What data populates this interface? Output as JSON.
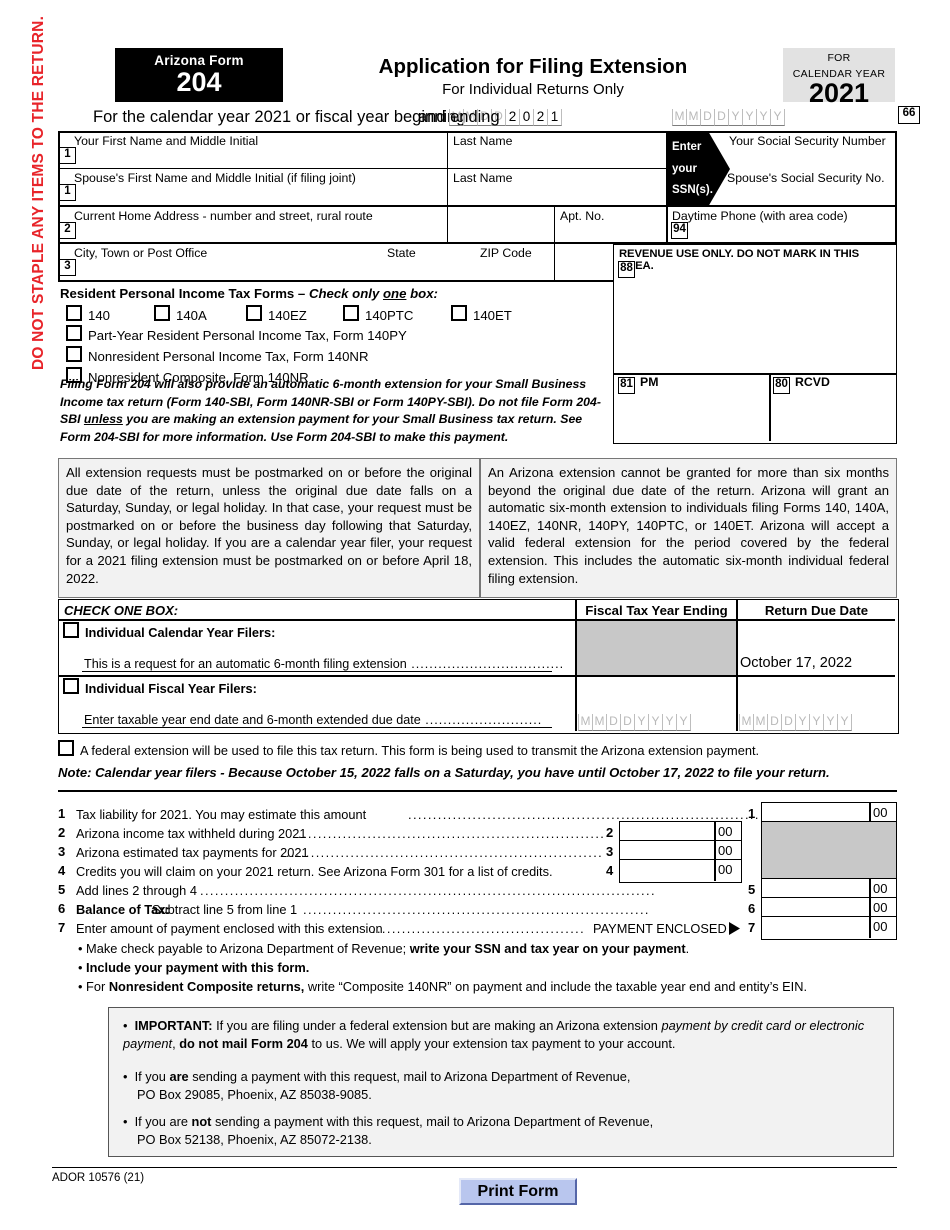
{
  "warning_vertical": "DO NOT STAPLE ANY ITEMS TO THE RETURN.",
  "header": {
    "agency_line": "Arizona Form",
    "form_number": "204",
    "title": "Application for Filing Extension",
    "subtitle": "For Individual Returns Only",
    "year_label_line1": "FOR",
    "year_label_line2": "CALENDAR YEAR",
    "year": "2021"
  },
  "calendar_line": {
    "prefix": "For the calendar year 2021 or fiscal year beginning",
    "middle": "and ending",
    "begin_year_digits": [
      "2",
      "0",
      "2",
      "1"
    ],
    "placeholder_mmdd": [
      "M",
      "M",
      "D",
      "D"
    ],
    "placeholder_mmddyyyy": [
      "M",
      "M",
      "D",
      "D",
      "Y",
      "Y",
      "Y",
      "Y"
    ],
    "box_number": "66"
  },
  "name_block": {
    "first_name_label": "Your First Name and Middle Initial",
    "last_name_label": "Last Name",
    "ssn_label": "Your Social Security Number",
    "spouse_first_name_label": "Spouse's First Name and Middle Initial (if filing joint)",
    "spouse_last_name_label": "Last Name",
    "spouse_ssn_label": "Spouse's Social Security No.",
    "address_label": "Current Home Address - number and street, rural route",
    "apt_label": "Apt. No.",
    "phone_label": "Daytime Phone (with area code)",
    "city_label": "City, Town or Post Office",
    "state_label": "State",
    "zip_label": "ZIP Code",
    "tag_1": "1",
    "tag_1b": "1",
    "tag_2": "2",
    "tag_3": "3",
    "box_94": "94",
    "ssn_arrow_text": [
      "Enter",
      "your",
      "SSN(s)."
    ]
  },
  "revenue_block": {
    "title": "REVENUE USE ONLY. DO NOT MARK IN THIS AREA.",
    "box_88": "88",
    "box_81": "81",
    "label_pm": "PM",
    "box_80": "80",
    "label_rcvd": "RCVD"
  },
  "resident_forms": {
    "heading_plain": "Resident Personal Income Tax Forms – ",
    "heading_italic_a": "Check only ",
    "heading_italic_u": "one",
    "heading_italic_b": " box:",
    "inline_options": [
      "140",
      "140A",
      "140EZ",
      "140PTC",
      "140ET"
    ],
    "stacked_options": [
      "Part-Year Resident Personal Income Tax, Form 140PY",
      "Nonresident Personal Income Tax, Form 140NR",
      "Nonresident Composite, Form 140NR"
    ]
  },
  "sbi_paragraph": {
    "part1": "Filing Form 204 will also provide an automatic 6-month extension for your Small Business Income tax return (Form 140-SBI, Form 140NR-SBI or Form 140PY-SBI).  Do not file Form 204-SBI ",
    "underline": "unless",
    "part2": " you are making an extension payment for your Small Business tax return. See Form 204-SBI for more information. Use Form 204-SBI to make this payment."
  },
  "instructions": {
    "left": "All extension requests must be postmarked on or before the original due date of the return, unless the original due date falls on a Saturday, Sunday, or legal holiday.  In that case, your request must be postmarked on or before the business day following that Saturday, Sunday, or legal holiday.  If you are a calendar year filer, your request for a 2021 filing extension must be postmarked on or before April 18, 2022.",
    "right": "An Arizona extension cannot be granted for more than six months beyond the original due date of the return.  Arizona will grant an automatic six-month extension to individuals filing Forms 140, 140A, 140EZ, 140NR, 140PY, 140PTC, or 140ET.   Arizona will accept a valid federal extension for the period covered by the federal extension.  This includes the automatic six-month individual federal filing extension."
  },
  "check_one_box": {
    "heading": "CHECK ONE BOX:",
    "col_fiscal": "Fiscal Tax Year Ending",
    "col_due": "Return Due Date",
    "row1_title": "Individual Calendar Year Filers:",
    "row1_desc": "This is a request for an automatic 6-month filing extension",
    "row1_due_date": "October 17, 2022",
    "row2_title": "Individual Fiscal Year Filers:",
    "row2_desc": "Enter taxable year end date and 6-month extended due date",
    "date_placeholder": [
      "M",
      "M",
      "D",
      "D",
      "Y",
      "Y",
      "Y",
      "Y"
    ]
  },
  "federal_extension_line": "A federal extension will be used to file this tax return.  This form is being used to transmit the Arizona extension payment.",
  "note_line": "Note:  Calendar year filers - Because October 15, 2022 falls on a Saturday, you have until October 17, 2022 to file your return.",
  "lines": [
    {
      "num": "1",
      "text": "Tax liability for 2021.  You may estimate this amount",
      "cents": "00",
      "wide": true
    },
    {
      "num": "2",
      "text": "Arizona income tax withheld during 2021",
      "cents": "00",
      "wide": false
    },
    {
      "num": "3",
      "text": "Arizona estimated tax payments for 2021",
      "cents": "00",
      "wide": false
    },
    {
      "num": "4",
      "text": "Credits you will claim on your 2021 return.  See Arizona Form 301 for a list of credits.",
      "cents": "00",
      "wide": false
    },
    {
      "num": "5",
      "text": "Add lines 2 through 4",
      "cents": "00",
      "wide": true
    },
    {
      "num": "6",
      "text_bold": "Balance of Tax:",
      "text": "  Subtract line 5 from line 1",
      "cents": "00",
      "wide": true
    },
    {
      "num": "7",
      "text": "Enter amount of payment enclosed with this extension",
      "trailing": "PAYMENT ENCLOSED",
      "cents": "00",
      "wide": true
    }
  ],
  "payment_bullets": [
    {
      "plain1": "Make check payable to Arizona Department of Revenue;  ",
      "bold": "write your SSN and tax year on your payment",
      "plain2": "."
    },
    {
      "bold": "Include your payment with this form.",
      "plain1": "",
      "plain2": ""
    },
    {
      "plain1": "For ",
      "bold": "Nonresident Composite returns,",
      "plain2": " write “Composite 140NR” on payment and include the taxable year end and entity’s EIN."
    }
  ],
  "important_box": {
    "b1_bold": "IMPORTANT:",
    "b1_t1": "  If you are filing under a federal extension but are making an Arizona extension ",
    "b1_i1": "payment by credit card or electronic payment",
    "b1_t2": ", ",
    "b1_b2": "do not mail Form 204",
    "b1_t3": " to us.  We will apply your extension tax payment to your account.",
    "b2_t1": "If you ",
    "b2_b1": "are",
    "b2_t2": " sending a payment with this request, mail to Arizona Department of Revenue,",
    "b2_line2": "PO Box 29085, Phoenix, AZ  85038-9085.",
    "b3_t1": "If you are ",
    "b3_b1": "not",
    "b3_t2": " sending a payment with this request, mail to Arizona Department of Revenue,",
    "b3_line2": "PO Box 52138, Phoenix, AZ  85072-2138."
  },
  "footer": {
    "ador": "ADOR 10576 (21)",
    "print_button": "Print Form"
  }
}
